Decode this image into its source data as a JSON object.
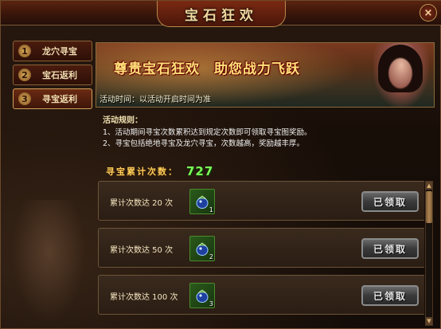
{
  "window": {
    "title": "宝石狂欢",
    "close_label": "×"
  },
  "sidebar": {
    "items": [
      {
        "num": "1",
        "label": "龙穴寻宝",
        "active": false
      },
      {
        "num": "2",
        "label": "宝石返利",
        "active": false
      },
      {
        "num": "3",
        "label": "寻宝返利",
        "active": true
      }
    ]
  },
  "banner": {
    "slogan": "尊贵宝石狂欢　助您战力飞跃",
    "time_text": "活动时间：以活动开启时间为准"
  },
  "rules": {
    "title": "活动规则：",
    "lines": [
      "1、活动期间寻宝次数累积达到规定次数即可领取寻宝图奖励。",
      "2、寻宝包括绝地寻宝及龙穴寻宝，次数越高，奖励越丰厚。"
    ]
  },
  "counter": {
    "label": "寻宝累计次数：",
    "value": "727"
  },
  "rewards": [
    {
      "label": "累计次数达 20 次",
      "item_icon": "treasure-bag-icon",
      "item_count": "1",
      "button_label": "已领取"
    },
    {
      "label": "累计次数达 50 次",
      "item_icon": "treasure-bag-icon",
      "item_count": "2",
      "button_label": "已领取"
    },
    {
      "label": "累计次数达 100 次",
      "item_icon": "treasure-bag-icon",
      "item_count": "3",
      "button_label": "已领取"
    }
  ],
  "colors": {
    "accent_gold": "#ffcf5a",
    "count_green": "#7dff5a",
    "frame_brown": "#6b4a2a"
  }
}
